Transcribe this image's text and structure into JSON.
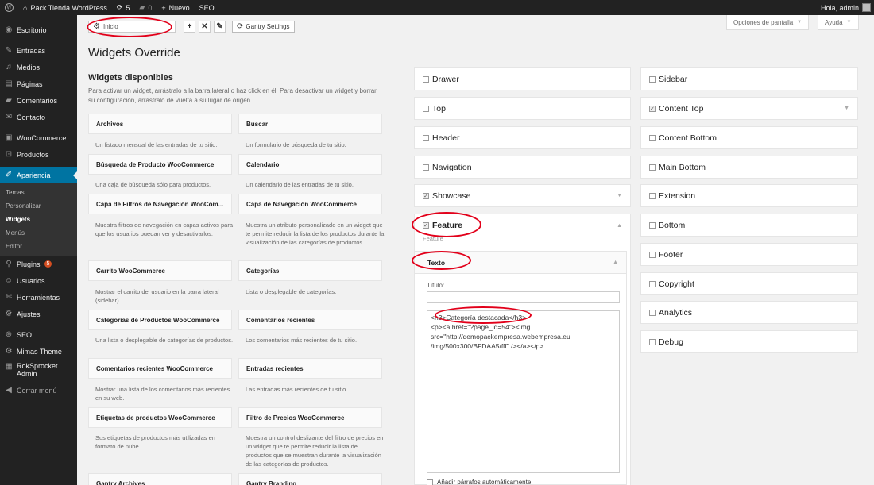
{
  "adminbar": {
    "site_name": "Pack Tienda WordPress",
    "updates_count": "5",
    "comments_count": "0",
    "new_label": "Nuevo",
    "seo_label": "SEO",
    "greeting": "Hola, admin"
  },
  "sidebar": {
    "items": [
      {
        "label": "Escritorio",
        "icon": "dashboard-icon"
      },
      {
        "label": "Entradas",
        "icon": "pin-icon"
      },
      {
        "label": "Medios",
        "icon": "media-icon"
      },
      {
        "label": "Páginas",
        "icon": "pages-icon"
      },
      {
        "label": "Comentarios",
        "icon": "comments-icon"
      },
      {
        "label": "Contacto",
        "icon": "contact-icon"
      },
      {
        "label": "WooCommerce",
        "icon": "woocommerce-icon"
      },
      {
        "label": "Productos",
        "icon": "products-icon"
      },
      {
        "label": "Apariencia",
        "icon": "appearance-icon"
      }
    ],
    "submenu": [
      "Temas",
      "Personalizar",
      "Widgets",
      "Menús",
      "Editor"
    ],
    "items2": [
      {
        "label": "Plugins",
        "icon": "plugins-icon",
        "badge": "5"
      },
      {
        "label": "Usuarios",
        "icon": "users-icon"
      },
      {
        "label": "Herramientas",
        "icon": "tools-icon"
      },
      {
        "label": "Ajustes",
        "icon": "settings-icon"
      },
      {
        "label": "SEO",
        "icon": "seo-icon"
      },
      {
        "label": "Mimas Theme",
        "icon": "theme-icon"
      },
      {
        "label": "RokSprocket Admin",
        "icon": "roksprocket-icon"
      },
      {
        "label": "Cerrar menú",
        "icon": "collapse-icon"
      }
    ]
  },
  "toolbar": {
    "select_value": "Inicio",
    "add_label": "+",
    "remove_label": "✕",
    "edit_label": "✎",
    "gantry_settings_label": "Gantry Settings",
    "screen_options_label": "Opciones de pantalla",
    "help_label": "Ayuda"
  },
  "page": {
    "title": "Widgets Override",
    "available_title": "Widgets disponibles",
    "available_desc": "Para activar un widget, arrástralo a la barra lateral o haz click en él. Para desactivar un widget y borrar su configuración, arrástralo de vuelta a su lugar de origen."
  },
  "widgets": [
    {
      "name": "Archivos",
      "desc": "Un listado mensual de las entradas de tu sitio."
    },
    {
      "name": "Buscar",
      "desc": "Un formulario de búsqueda de tu sitio."
    },
    {
      "name": "Búsqueda de Producto WooCommerce",
      "desc": "Una caja de búsqueda sólo para productos."
    },
    {
      "name": "Calendario",
      "desc": "Un calendario de las entradas de tu sitio."
    },
    {
      "name": "Capa de Filtros de Navegación WooCom...",
      "desc": "Muestra filtros de navegación en capas activos para que los usuarios puedan ver y desactivarlos."
    },
    {
      "name": "Capa de Navegación WooCommerce",
      "desc": "Muestra un atributo personalizado en un widget que te permite reducir la lista de los productos durante la visualización de las categorías de productos."
    },
    {
      "name": "Carrito WooCommerce",
      "desc": "Mostrar el carrito del usuario en la barra lateral (sidebar)."
    },
    {
      "name": "Categorías",
      "desc": "Lista o desplegable de categorías."
    },
    {
      "name": "Categorías de Productos WooCommerce",
      "desc": "Una lista o desplegable de categorías de productos."
    },
    {
      "name": "Comentarios recientes",
      "desc": "Los comentarios más recientes de tu sitio."
    },
    {
      "name": "Comentarios recientes WooCommerce",
      "desc": "Mostrar una lista de los comentarios más recientes en su web."
    },
    {
      "name": "Entradas recientes",
      "desc": "Las entradas más recientes de tu sitio."
    },
    {
      "name": "Etiquetas de productos WooCommerce",
      "desc": "Sus etiquetas de productos más utilizadas en formato de nube."
    },
    {
      "name": "Filtro de Precios WooCommerce",
      "desc": "Muestra un control deslizante del filtro de precios en un widget que te permite reducir la lista de productos que se muestran durante la visualización de las categorías de productos."
    },
    {
      "name": "Gantry Archives",
      "desc": ""
    },
    {
      "name": "Gantry Branding",
      "desc": ""
    }
  ],
  "positions_left": [
    {
      "name": "Drawer",
      "checked": false,
      "arrow": ""
    },
    {
      "name": "Top",
      "checked": false,
      "arrow": ""
    },
    {
      "name": "Header",
      "checked": false,
      "arrow": ""
    },
    {
      "name": "Navigation",
      "checked": false,
      "arrow": ""
    },
    {
      "name": "Showcase",
      "checked": true,
      "arrow": "▼"
    },
    {
      "name": "Feature",
      "checked": true,
      "arrow": "▲"
    }
  ],
  "positions_right": [
    {
      "name": "Sidebar",
      "checked": false,
      "arrow": ""
    },
    {
      "name": "Content Top",
      "checked": true,
      "arrow": "▼"
    },
    {
      "name": "Content Bottom",
      "checked": false,
      "arrow": ""
    },
    {
      "name": "Main Bottom",
      "checked": false,
      "arrow": ""
    },
    {
      "name": "Extension",
      "checked": false,
      "arrow": ""
    },
    {
      "name": "Bottom",
      "checked": false,
      "arrow": ""
    },
    {
      "name": "Footer",
      "checked": false,
      "arrow": ""
    },
    {
      "name": "Copyright",
      "checked": false,
      "arrow": ""
    },
    {
      "name": "Analytics",
      "checked": false,
      "arrow": ""
    },
    {
      "name": "Debug",
      "checked": false,
      "arrow": ""
    }
  ],
  "feature_panel": {
    "sub_label": "Feature",
    "text_widget_title": "Texto",
    "title_field_label": "Título:",
    "title_field_value": "",
    "content": "<h3>Categoría destacada</h3>\n<p><a href=\"?page_id=54\"><img\nsrc=\"http://demopackempresa.webempresa.eu\n/img/500x300/BFDAA5/fff\" /></a></p>",
    "auto_paragraph_label": "Añadir párrafos automáticamente"
  }
}
